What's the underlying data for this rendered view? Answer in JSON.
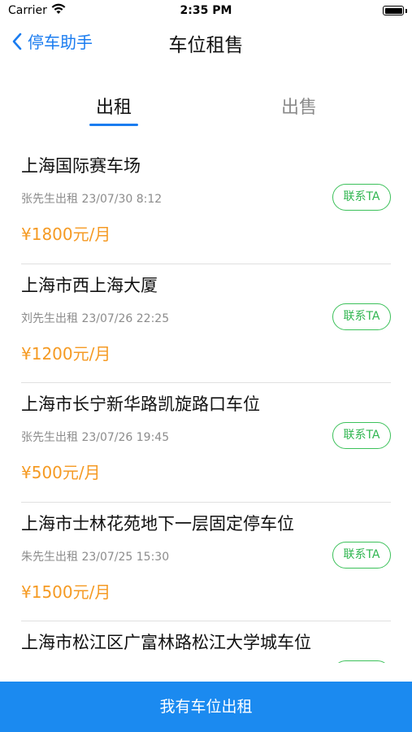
{
  "status_bar": {
    "carrier": "Carrier",
    "time": "2:35 PM"
  },
  "nav": {
    "back_label": "停车助手",
    "title": "车位租售"
  },
  "tabs": [
    {
      "label": "出租",
      "active": true
    },
    {
      "label": "出售",
      "active": false
    }
  ],
  "listings": [
    {
      "title": "上海国际赛车场",
      "meta": "张先生出租 23/07/30 8:12",
      "price": "¥1800元/月",
      "contact_label": "联系TA"
    },
    {
      "title": "上海市西上海大厦",
      "meta": "刘先生出租 23/07/26 22:25",
      "price": "¥1200元/月",
      "contact_label": "联系TA"
    },
    {
      "title": "上海市长宁新华路凯旋路口车位",
      "meta": "张先生出租 23/07/26 19:45",
      "price": "¥500元/月",
      "contact_label": "联系TA"
    },
    {
      "title": "上海市士林花苑地下一层固定停车位",
      "meta": "朱先生出租 23/07/25 15:30",
      "price": "¥1500元/月",
      "contact_label": "联系TA"
    },
    {
      "title": "上海市松江区广富林路松江大学城车位",
      "meta": "",
      "price": "",
      "contact_label": ""
    }
  ],
  "bottom_action": {
    "label": "我有车位出租"
  },
  "colors": {
    "accent": "#1a7cf0",
    "price": "#f59a23",
    "contact": "#3cc15a",
    "bottom_bar": "#1b8af0"
  },
  "icons": {
    "back": "chevron-left-icon",
    "wifi": "wifi-icon",
    "battery": "battery-icon"
  }
}
